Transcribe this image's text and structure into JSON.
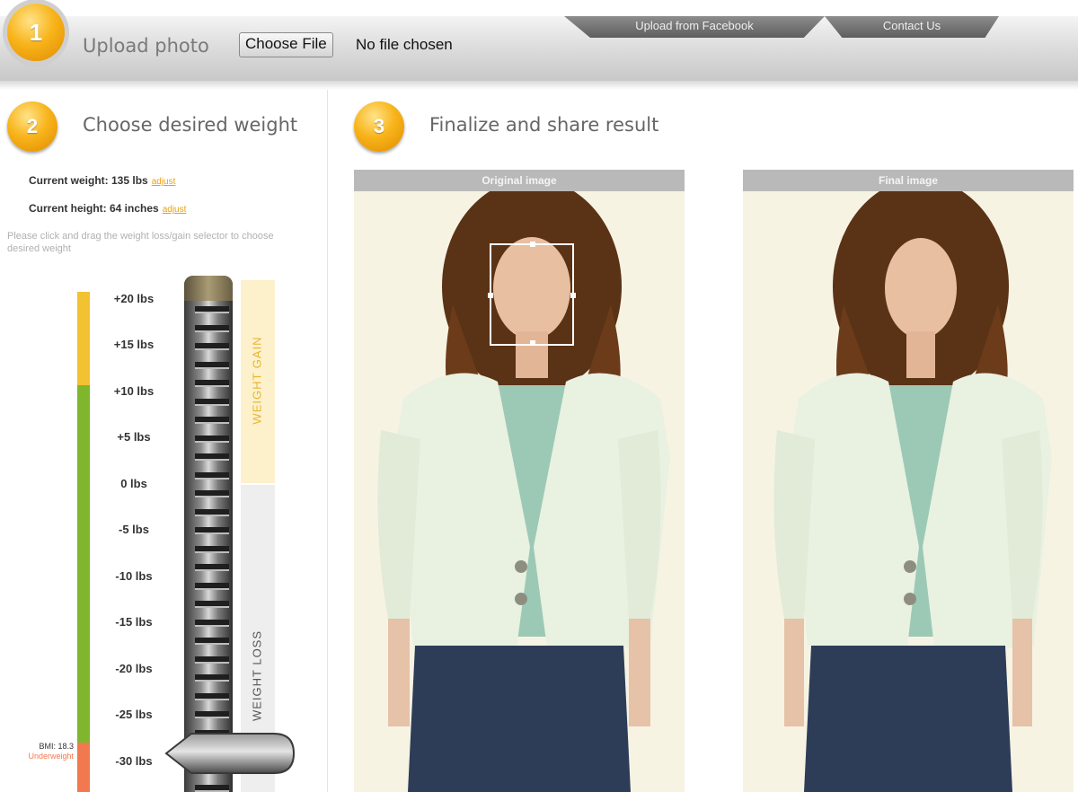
{
  "header": {
    "tabs": [
      {
        "label": "Upload from Facebook"
      },
      {
        "label": "Contact Us"
      }
    ]
  },
  "steps": {
    "step1": {
      "number": "1",
      "title": "Upload photo"
    },
    "step2": {
      "number": "2",
      "title": "Choose desired weight"
    },
    "step3": {
      "number": "3",
      "title": "Finalize and share result"
    }
  },
  "upload": {
    "button_label": "Choose File",
    "status": "No file chosen"
  },
  "stats": {
    "current_weight": "Current weight: 135 lbs",
    "current_height": "Current height: 64 inches",
    "adjust_label": "adjust"
  },
  "instructions": "Please click and drag the weight loss/gain selector to choose desired weight",
  "scale": {
    "labels": [
      "+20 lbs",
      "+15 lbs",
      "+10 lbs",
      "+5 lbs",
      "0 lbs",
      "-5 lbs",
      "-10 lbs",
      "-15 lbs",
      "-20 lbs",
      "-25 lbs",
      "-30 lbs"
    ],
    "gain_label": "WEIGHT GAIN",
    "loss_label": "WEIGHT LOSS",
    "selected": "-30 lbs"
  },
  "bmi": {
    "value": "BMI: 18.3",
    "category": "Underweight"
  },
  "colors": {
    "accent": "#f8b41a",
    "bmi_overweight": "#f2c232",
    "bmi_normal": "#7fb62e",
    "bmi_underweight": "#f2794f"
  },
  "photos": {
    "original_title": "Original image",
    "final_title": "Final image"
  },
  "icons": {
    "step_badge": "orange-circle-number-icon",
    "handle": "slider-arrow-handle-icon"
  }
}
